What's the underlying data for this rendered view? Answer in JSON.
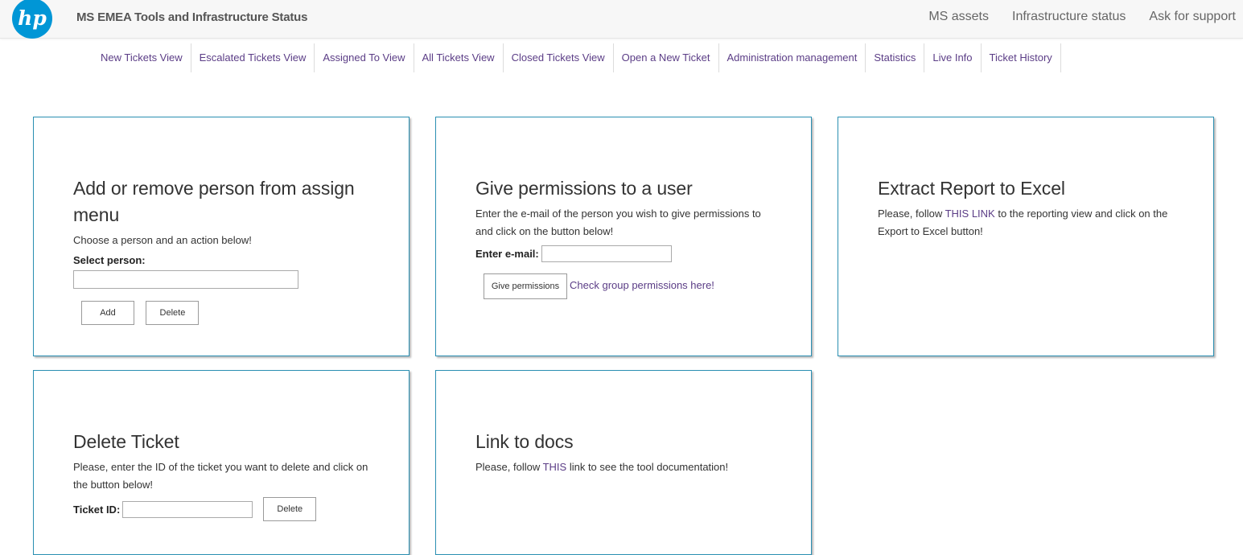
{
  "header": {
    "title": "MS EMEA Tools and Infrastructure Status",
    "logo_text": "hp",
    "links": [
      "MS assets",
      "Infrastructure status",
      "Ask for support"
    ]
  },
  "nav": {
    "items": [
      "New Tickets View",
      "Escalated Tickets View",
      "Assigned To View",
      "All Tickets View",
      "Closed Tickets View",
      "Open a New Ticket",
      "Administration management",
      "Statistics",
      "Live Info",
      "Ticket History"
    ]
  },
  "cards": {
    "assign": {
      "title": "Add or remove person from assign menu",
      "desc": "Choose a person and an action below!",
      "select_label": "Select person:",
      "select_value": "",
      "add_label": "Add",
      "delete_label": "Delete"
    },
    "permissions": {
      "title": "Give permissions to a user",
      "desc": "Enter the e-mail of the person you wish to give permissions to and click on the button below!",
      "email_label": "Enter e-mail:",
      "email_value": "",
      "button_label": "Give permissions",
      "group_link": "Check group permissions here!"
    },
    "excel": {
      "title": "Extract Report to Excel",
      "desc_before": "Please, follow ",
      "desc_link": "THIS LINK",
      "desc_after": " to the reporting view and click on the Export to Excel button!"
    },
    "delete_ticket": {
      "title": "Delete Ticket",
      "desc": "Please, enter the ID of the ticket you want to delete and click on the button below!",
      "id_label": "Ticket ID:",
      "id_value": "",
      "delete_label": "Delete"
    },
    "docs": {
      "title": "Link to docs",
      "desc_before": "Please, follow ",
      "desc_link": "THIS",
      "desc_after": " link to see the tool documentation!"
    }
  },
  "colors": {
    "accent": "#2a8fb2",
    "link": "#5b3d86",
    "logo_blue": "#0096d6"
  }
}
